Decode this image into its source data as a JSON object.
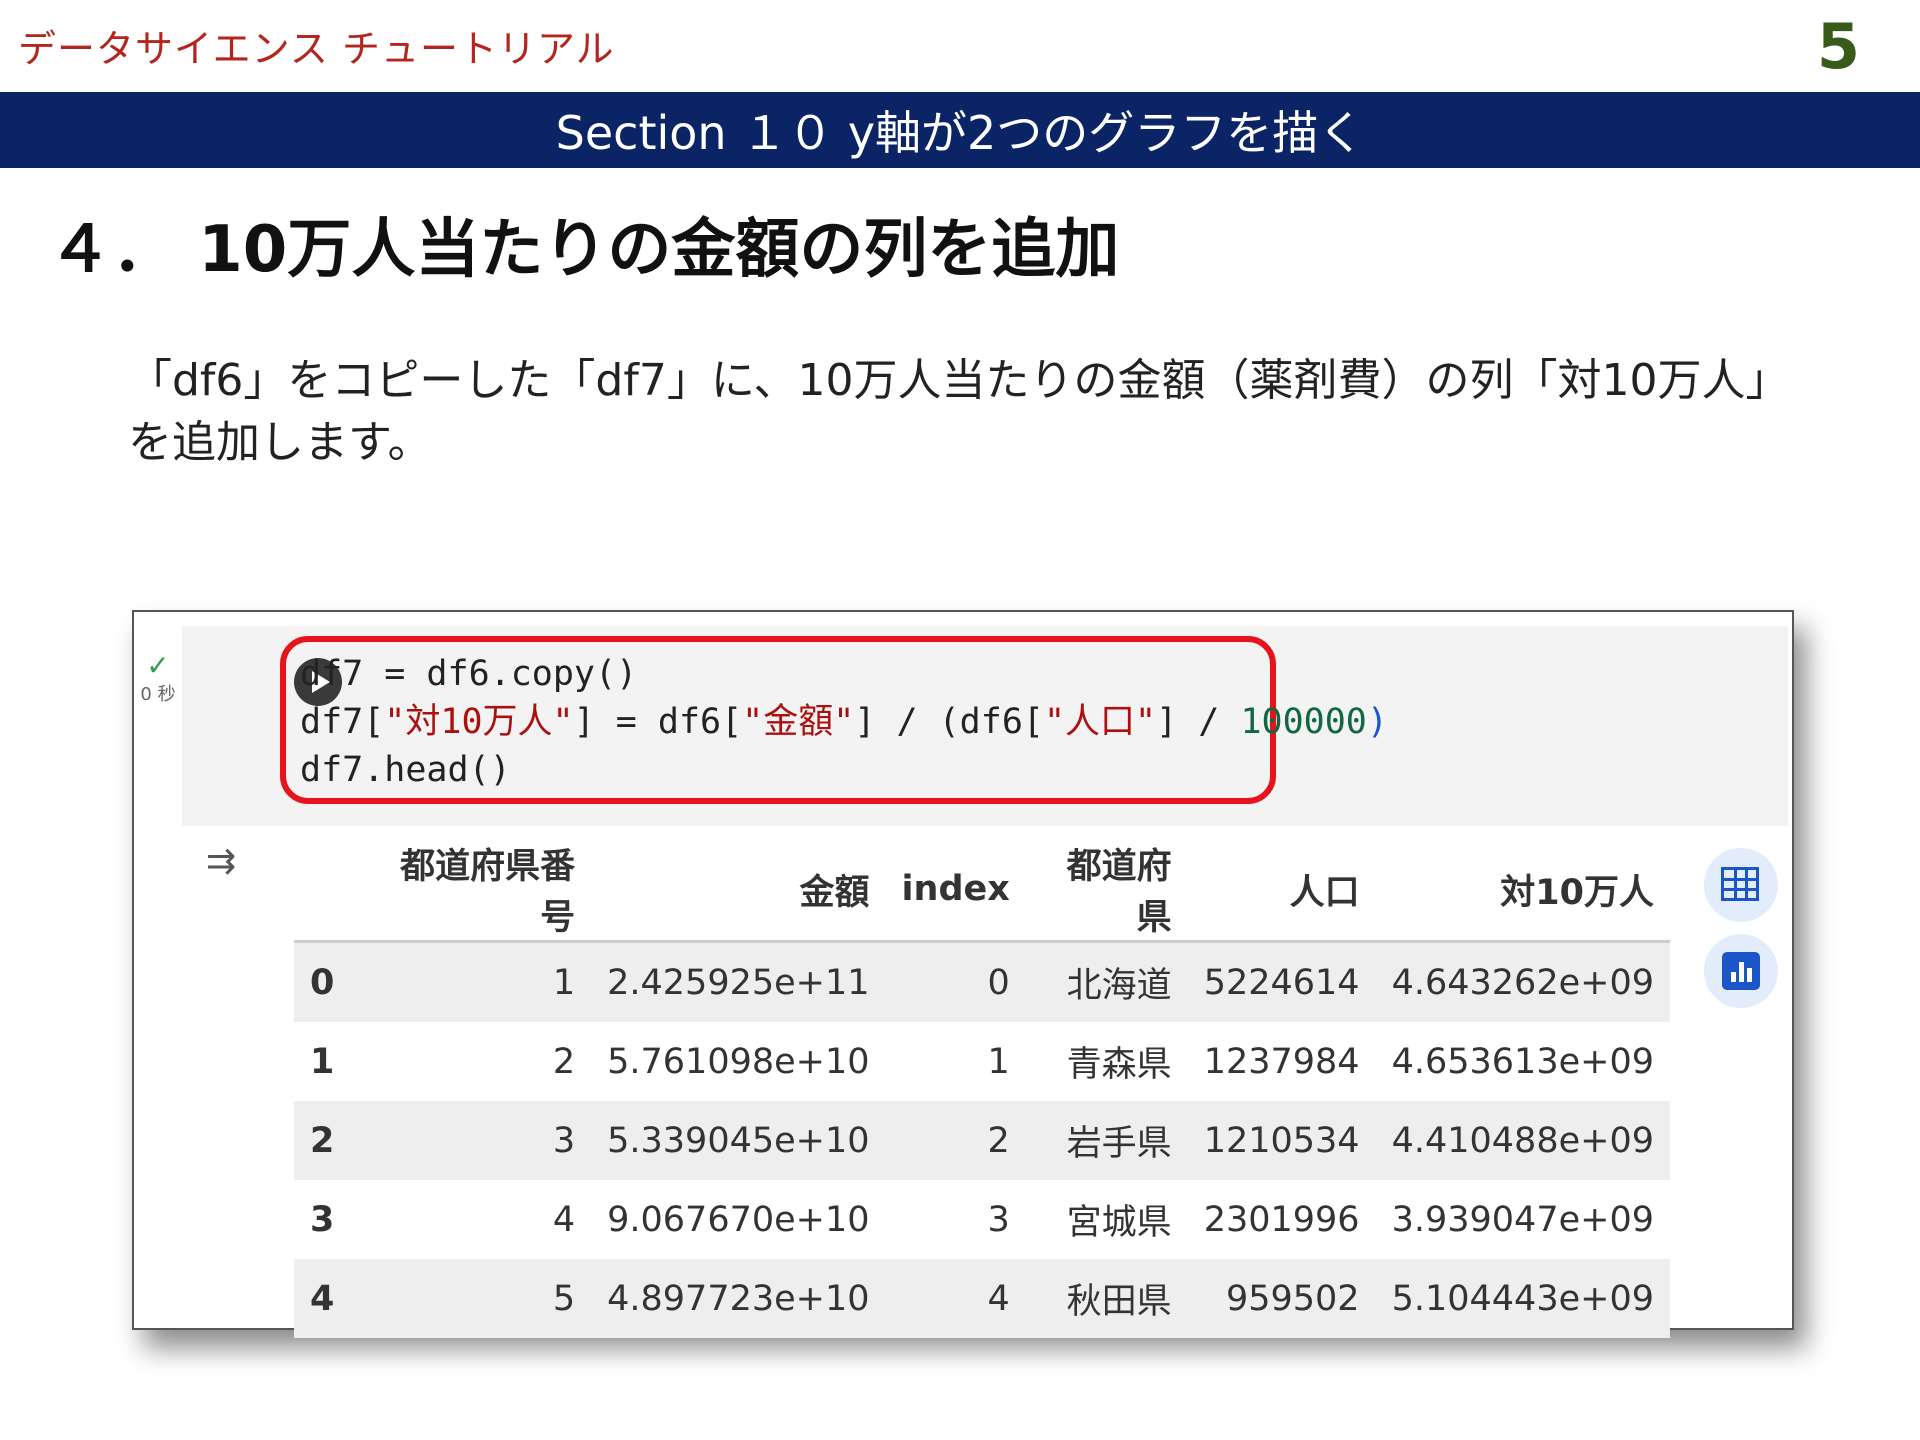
{
  "header": {
    "brand": "データサイエンス チュートリアル",
    "page_number": "5",
    "section_title": "Section １０ y軸が2つのグラフを描く"
  },
  "heading": "４． 10万人当たりの金額の列を追加",
  "description": "「df6」をコピーした「df7」に、10万人当たりの金額（薬剤費）の列「対10万人」を追加します。",
  "notebook": {
    "cell_status": "✓",
    "exec_time": "0 秒",
    "code": {
      "line1": "df7 = df6.copy()",
      "line2_a": "df7[",
      "line2_b": "\"対10万人\"",
      "line2_c": "] = df6[",
      "line2_d": "\"金額\"",
      "line2_e": "] / (df6[",
      "line2_f": "\"人口\"",
      "line2_g": "] / ",
      "line2_h": "100000",
      "line2_i": ")",
      "line3": "df7.head()"
    },
    "table": {
      "columns": [
        "都道府県番号",
        "金額",
        "index",
        "都道府県",
        "人口",
        "対10万人"
      ],
      "rows": [
        {
          "idx": "0",
          "cells": [
            "1",
            "2.425925e+11",
            "0",
            "北海道",
            "5224614",
            "4.643262e+09"
          ]
        },
        {
          "idx": "1",
          "cells": [
            "2",
            "5.761098e+10",
            "1",
            "青森県",
            "1237984",
            "4.653613e+09"
          ]
        },
        {
          "idx": "2",
          "cells": [
            "3",
            "5.339045e+10",
            "2",
            "岩手県",
            "1210534",
            "4.410488e+09"
          ]
        },
        {
          "idx": "3",
          "cells": [
            "4",
            "9.067670e+10",
            "3",
            "宮城県",
            "2301996",
            "3.939047e+09"
          ]
        },
        {
          "idx": "4",
          "cells": [
            "5",
            "4.897723e+10",
            "4",
            "秋田県",
            "959502",
            "5.104443e+09"
          ]
        }
      ]
    },
    "icons": {
      "run": "play-icon",
      "output": "output-toggle-icon",
      "table_view": "table-icon",
      "chart": "chart-icon"
    }
  }
}
